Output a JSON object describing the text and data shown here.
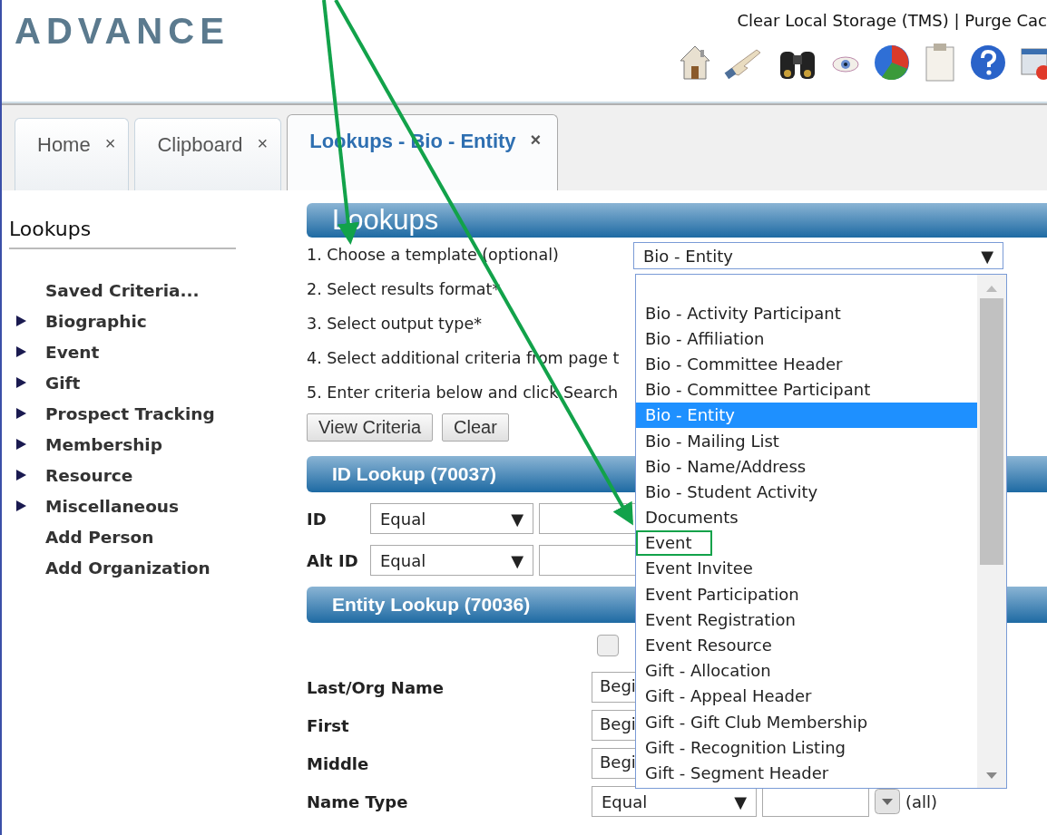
{
  "header": {
    "logo": "ADVANCE",
    "links": "Clear Local Storage (TMS) | Purge Cac"
  },
  "tabs": [
    {
      "label": "Home",
      "close": "×",
      "selected": false
    },
    {
      "label": "Clipboard",
      "close": "×",
      "selected": false
    },
    {
      "label": "Lookups - Bio - Entity",
      "close": "×",
      "selected": true
    }
  ],
  "sidebar": {
    "title": "Lookups",
    "items": [
      {
        "label": "Saved Criteria...",
        "kind": "link"
      },
      {
        "label": "Biographic",
        "kind": "group",
        "expanded": false
      },
      {
        "label": "Event",
        "kind": "group",
        "expanded": false
      },
      {
        "label": "Gift",
        "kind": "group",
        "expanded": false
      },
      {
        "label": "Prospect Tracking",
        "kind": "group",
        "expanded": false
      },
      {
        "label": "Membership",
        "kind": "group",
        "expanded": false
      },
      {
        "label": "Resource",
        "kind": "group",
        "expanded": false
      },
      {
        "label": "Miscellaneous",
        "kind": "group",
        "expanded": false
      },
      {
        "label": "Add Person",
        "kind": "link"
      },
      {
        "label": "Add Organization",
        "kind": "link"
      }
    ]
  },
  "lookups": {
    "title": "Lookups",
    "steps": [
      "1. Choose a template (optional)",
      "2. Select results format*",
      "3. Select output type*",
      "4. Select additional criteria from page t",
      "5. Enter criteria below and click Search"
    ],
    "template_select": {
      "value": "Bio - Entity",
      "arrow": "▼"
    },
    "buttons": [
      "View Criteria",
      "Clear"
    ]
  },
  "dropdown": {
    "items": [
      {
        "label": "Bio - Activity Participant",
        "selected": false,
        "boxed": false
      },
      {
        "label": "Bio - Affiliation",
        "selected": false,
        "boxed": false
      },
      {
        "label": "Bio - Committee Header",
        "selected": false,
        "boxed": false
      },
      {
        "label": "Bio - Committee Participant",
        "selected": false,
        "boxed": false
      },
      {
        "label": "Bio - Entity",
        "selected": true,
        "boxed": false
      },
      {
        "label": "Bio - Mailing List",
        "selected": false,
        "boxed": false
      },
      {
        "label": "Bio - Name/Address",
        "selected": false,
        "boxed": false
      },
      {
        "label": "Bio - Student Activity",
        "selected": false,
        "boxed": false
      },
      {
        "label": "Documents",
        "selected": false,
        "boxed": false
      },
      {
        "label": "Event",
        "selected": false,
        "boxed": true
      },
      {
        "label": "Event Invitee",
        "selected": false,
        "boxed": false
      },
      {
        "label": "Event Participation",
        "selected": false,
        "boxed": false
      },
      {
        "label": "Event Registration",
        "selected": false,
        "boxed": false
      },
      {
        "label": "Event Resource",
        "selected": false,
        "boxed": false
      },
      {
        "label": "Gift - Allocation",
        "selected": false,
        "boxed": false
      },
      {
        "label": "Gift - Appeal Header",
        "selected": false,
        "boxed": false
      },
      {
        "label": "Gift - Gift Club Membership",
        "selected": false,
        "boxed": false
      },
      {
        "label": "Gift - Recognition Listing",
        "selected": false,
        "boxed": false
      },
      {
        "label": "Gift - Segment Header",
        "selected": false,
        "boxed": false
      }
    ]
  },
  "id_lookup": {
    "title": "ID Lookup (70037)",
    "rows": [
      {
        "label": "ID",
        "operator": "Equal",
        "arrow": "▼"
      },
      {
        "label": "Alt ID",
        "operator": "Equal",
        "arrow": "▼"
      }
    ]
  },
  "entity_lookup": {
    "title": "Entity Lookup (70036)",
    "checked": false,
    "rows": [
      {
        "kind": "text",
        "label": "Last/Org Name",
        "operator": "Begi"
      },
      {
        "kind": "text",
        "label": "First",
        "operator": "Begi"
      },
      {
        "kind": "text",
        "label": "Middle",
        "operator": "Begi"
      },
      {
        "kind": "code",
        "label": "Name Type",
        "operator": "Equal",
        "arrow": "▼",
        "note": "(all)"
      }
    ]
  }
}
